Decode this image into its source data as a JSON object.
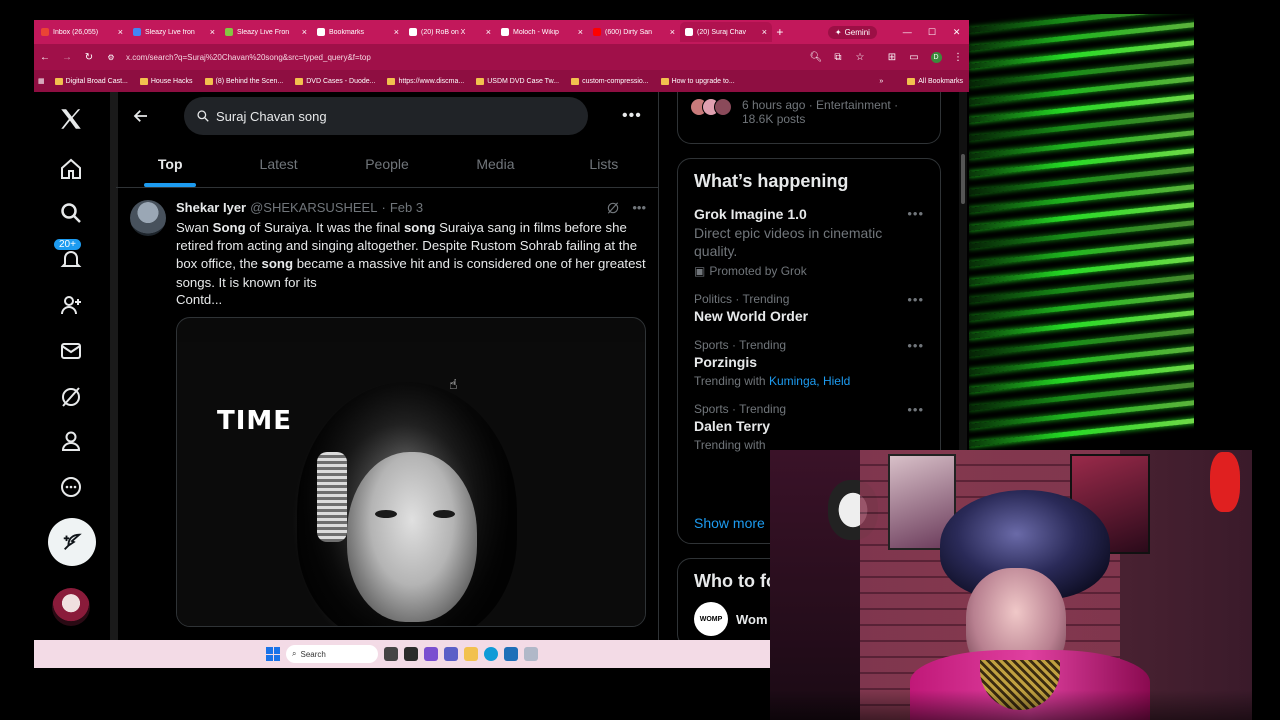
{
  "browser": {
    "tabs": [
      {
        "title": "Inbox (26,055)",
        "icon": "gmail-icon",
        "color": "#ea4335"
      },
      {
        "title": "Sleazy Live fron",
        "icon": "site-icon",
        "color": "#4285f4"
      },
      {
        "title": "Sleazy Live Fron",
        "icon": "rumble-icon",
        "color": "#85c742"
      },
      {
        "title": "Bookmarks",
        "icon": "star-icon",
        "color": "#ffffff"
      },
      {
        "title": "(20) RoB on X",
        "icon": "x-icon",
        "color": "#ffffff"
      },
      {
        "title": "Moloch - Wikip",
        "icon": "wikipedia-icon",
        "color": "#ffffff"
      },
      {
        "title": "(600) Dirty San",
        "icon": "youtube-icon",
        "color": "#ff0000"
      },
      {
        "title": "(20) Suraj Chav",
        "icon": "x-icon",
        "color": "#ffffff"
      }
    ],
    "gemini_label": "Gemini",
    "url": "x.com/search?q=Suraj%20Chavan%20song&src=typed_query&f=top",
    "bookmarks": [
      "Digital Broad Cast...",
      "House Hacks",
      "(8) Behind the Scen...",
      "DVD Cases - Duode...",
      "https://www.discma...",
      "USDM DVD Case Tw...",
      "custom-compressio...",
      "How to upgrade to..."
    ],
    "all_bookmarks": "All Bookmarks",
    "profile_initial": "D"
  },
  "x": {
    "notification_badge": "20+",
    "search_query": "Suraj Chavan song",
    "tabs": [
      "Top",
      "Latest",
      "People",
      "Media",
      "Lists"
    ],
    "active_tab": "Top",
    "tweet": {
      "name": "Shekar Iyer",
      "handle": "@SHEKARSUSHEEL",
      "sep": "·",
      "date": "Feb 3",
      "text_parts": [
        {
          "t": "Swan ",
          "b": false
        },
        {
          "t": "Song",
          "b": true
        },
        {
          "t": " of Suraiya. It was the final ",
          "b": false
        },
        {
          "t": "song",
          "b": true
        },
        {
          "t": " Suraiya sang in films before she retired from acting and singing altogether. Despite Rustom Sohrab failing at the box office, the ",
          "b": false
        },
        {
          "t": "song",
          "b": true
        },
        {
          "t": " became a massive hit and is considered one of her greatest songs. It is known for its",
          "b": false
        }
      ],
      "contd": "Contd...",
      "media_caption": "TIME"
    },
    "trend_top": {
      "meta_line1": "6 hours ago · Entertainment ·",
      "meta_line2": "18.6K posts"
    },
    "happening": {
      "title": "What’s happening",
      "items": [
        {
          "meta": "",
          "name": "Grok Imagine 1.0",
          "desc": "Direct epic videos in cinematic quality.",
          "promo": "Promoted by Grok",
          "with": "",
          "links": ""
        },
        {
          "meta": "Politics · Trending",
          "name": "New World Order",
          "desc": "",
          "promo": "",
          "with": "",
          "links": ""
        },
        {
          "meta": "Sports · Trending",
          "name": "Porzingis",
          "desc": "",
          "promo": "",
          "with": "Trending with",
          "links": "Kuminga, Hield"
        },
        {
          "meta": "Sports · Trending",
          "name": "Dalen Terry",
          "desc": "",
          "promo": "",
          "with": "Trending with",
          "links": ""
        }
      ],
      "show_more": "Show more"
    },
    "who_to_follow": {
      "title": "Who to follow",
      "first_name": "Wom",
      "first_avatar_text": "WOMP"
    }
  },
  "taskbar": {
    "search_placeholder": "Search"
  },
  "colors": {
    "accent": "#1d9bf0",
    "browser_frame": "#c2185b"
  }
}
